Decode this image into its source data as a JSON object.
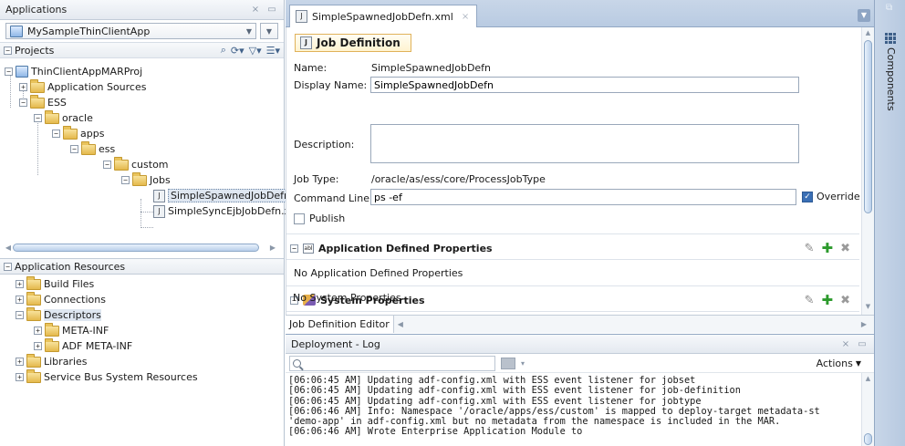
{
  "applications": {
    "title": "Applications",
    "app_name": "MySampleThinClientApp"
  },
  "projects": {
    "title": "Projects",
    "tree": [
      {
        "label": "ThinClientAppMARProj",
        "expander": "−"
      },
      {
        "label": "Application Sources",
        "expander": "+"
      },
      {
        "label": "ESS",
        "expander": "−"
      },
      {
        "label": "oracle",
        "expander": "−"
      },
      {
        "label": "apps",
        "expander": "−"
      },
      {
        "label": "ess",
        "expander": "−"
      },
      {
        "label": "custom",
        "expander": "−"
      },
      {
        "label": "Jobs",
        "expander": "−"
      },
      {
        "label": "SimpleSpawnedJobDefn.:",
        "expander": ""
      },
      {
        "label": "SimpleSyncEjbJobDefn.x",
        "expander": ""
      }
    ]
  },
  "app_resources": {
    "title": "Application Resources",
    "tree": [
      {
        "label": "Build Files",
        "expander": "+"
      },
      {
        "label": "Connections",
        "expander": "+"
      },
      {
        "label": "Descriptors",
        "expander": "−"
      },
      {
        "label": "META-INF",
        "expander": "+"
      },
      {
        "label": "ADF META-INF",
        "expander": "+"
      },
      {
        "label": "Libraries",
        "expander": "+"
      },
      {
        "label": "Service Bus System Resources",
        "expander": "+"
      }
    ]
  },
  "editor": {
    "tab_label": "SimpleSpawnedJobDefn.xml",
    "section_title": "Job Definition",
    "name_label": "Name:",
    "name_value": "SimpleSpawnedJobDefn",
    "display_name_label": "Display Name:",
    "display_name_value": "SimpleSpawnedJobDefn",
    "description_label": "Description:",
    "job_type_label": "Job Type:",
    "job_type_value": "/oracle/as/ess/core/ProcessJobType",
    "command_line_label": "Command Line:",
    "command_line_value": "ps -ef",
    "override_label": "Override",
    "override_checked": true,
    "publish_label": "Publish",
    "publish_checked": false,
    "app_props_title": "Application Defined Properties",
    "app_props_empty": "No Application Defined Properties",
    "sys_props_title": "System Properties",
    "sys_props_empty": "No System Properties",
    "bottom_tab": "Job Definition Editor"
  },
  "components": {
    "label": "Components"
  },
  "log": {
    "title": "Deployment - Log",
    "actions_label": "Actions",
    "lines": [
      "[06:06:45 AM] Updating adf-config.xml with ESS event listener for jobset",
      "[06:06:45 AM] Updating adf-config.xml with ESS event listener for job-definition",
      "[06:06:45 AM] Updating adf-config.xml with ESS event listener for jobtype",
      "[06:06:46 AM] Info: Namespace '/oracle/apps/ess/custom' is mapped to deploy-target metadata-st",
      "'demo-app' in adf-config.xml but no metadata from the namespace is included in the MAR.",
      "[06:06:46 AM] Wrote Enterprise Application Module to"
    ]
  },
  "colors": {
    "accent": "#3a6fb5",
    "tab_strip": "#c8d6e8",
    "folder": "#e4b94c",
    "title_border": "#e0b25a",
    "add_green": "#2c9a2c"
  }
}
